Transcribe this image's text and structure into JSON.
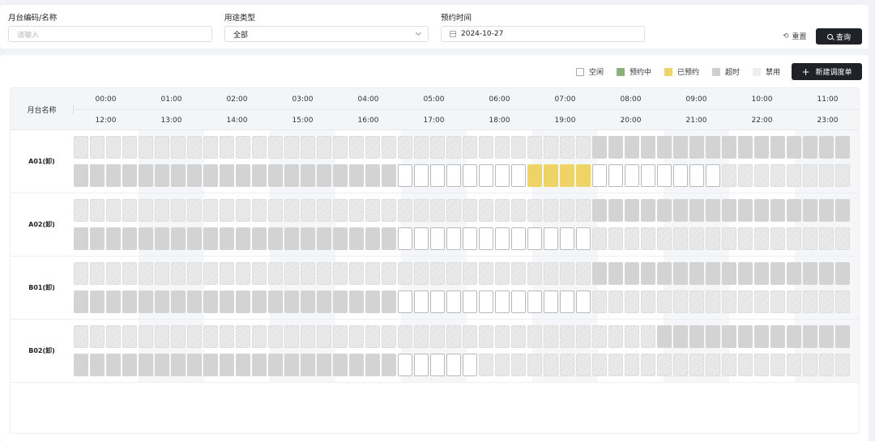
{
  "filters": {
    "code_label": "月台编码/名称",
    "code_placeholder": "请输入",
    "type_label": "用途类型",
    "type_value": "全部",
    "time_label": "预约时间",
    "time_value": "2024-10-27",
    "reset_label": "重置",
    "query_label": "查询"
  },
  "legend": [
    {
      "label": "空闲",
      "state": "free"
    },
    {
      "label": "预约中",
      "state": "reserving"
    },
    {
      "label": "已预约",
      "state": "reserved"
    },
    {
      "label": "超时",
      "state": "overtime"
    },
    {
      "label": "禁用",
      "state": "disabled"
    }
  ],
  "new_button_label": "新建调度单",
  "table": {
    "name_header": "月台名称",
    "hours_top": [
      "00:00",
      "01:00",
      "02:00",
      "03:00",
      "04:00",
      "05:00",
      "06:00",
      "07:00",
      "08:00",
      "09:00",
      "10:00",
      "11:00"
    ],
    "hours_bottom": [
      "12:00",
      "13:00",
      "14:00",
      "15:00",
      "16:00",
      "17:00",
      "18:00",
      "19:00",
      "20:00",
      "21:00",
      "22:00",
      "23:00"
    ],
    "rows": [
      {
        "name": "A01(卸)",
        "am": "DDDDDDDDDDDDDDDDDDDDDDDDDDDDDDDDOOOOOOOOOOOOOOOO",
        "pm": "OOOOOOOOOOOOOOOOOOOOFFFFFFFFRRRRFFFFFFFFDDDDDDDD"
      },
      {
        "name": "A02(卸)",
        "am": "DDDDDDDDDDDDDDDDDDDDDDDDDDDDDDDDOOOOOOOOOOOOOOOO",
        "pm": "OOOOOOOOOOOOOOOOOOOOFFFFFFFFFFFFDDDDDDDDDDDDDDDD"
      },
      {
        "name": "B01(卸)",
        "am": "DDDDDDDDDDDDDDDDDDDDDDDDDDDDDDDDOOOOOOOOOOOOOOOO",
        "pm": "OOOOOOOOOOOOOOOOOOOOFFFFFFFFFFFFDDDDDDDDDDDDDDDD"
      },
      {
        "name": "B02(卸)",
        "am": "DDDDDDDDDDDDDDDDDDDDDDDDDDDDDDDDDDDDOOOOOOOOOOOO",
        "pm": "OOOOOOOOOOOOOOOOOOOOFFFFFDDDDDDDDDDDDDDDDDDDDDDD"
      }
    ]
  },
  "colors": {
    "free": "#ffffff",
    "reserving": "#8cb07a",
    "reserved": "#eed366",
    "overtime": "#d3d3d3",
    "disabled": "#ececec",
    "primary_button": "#1f2229"
  }
}
